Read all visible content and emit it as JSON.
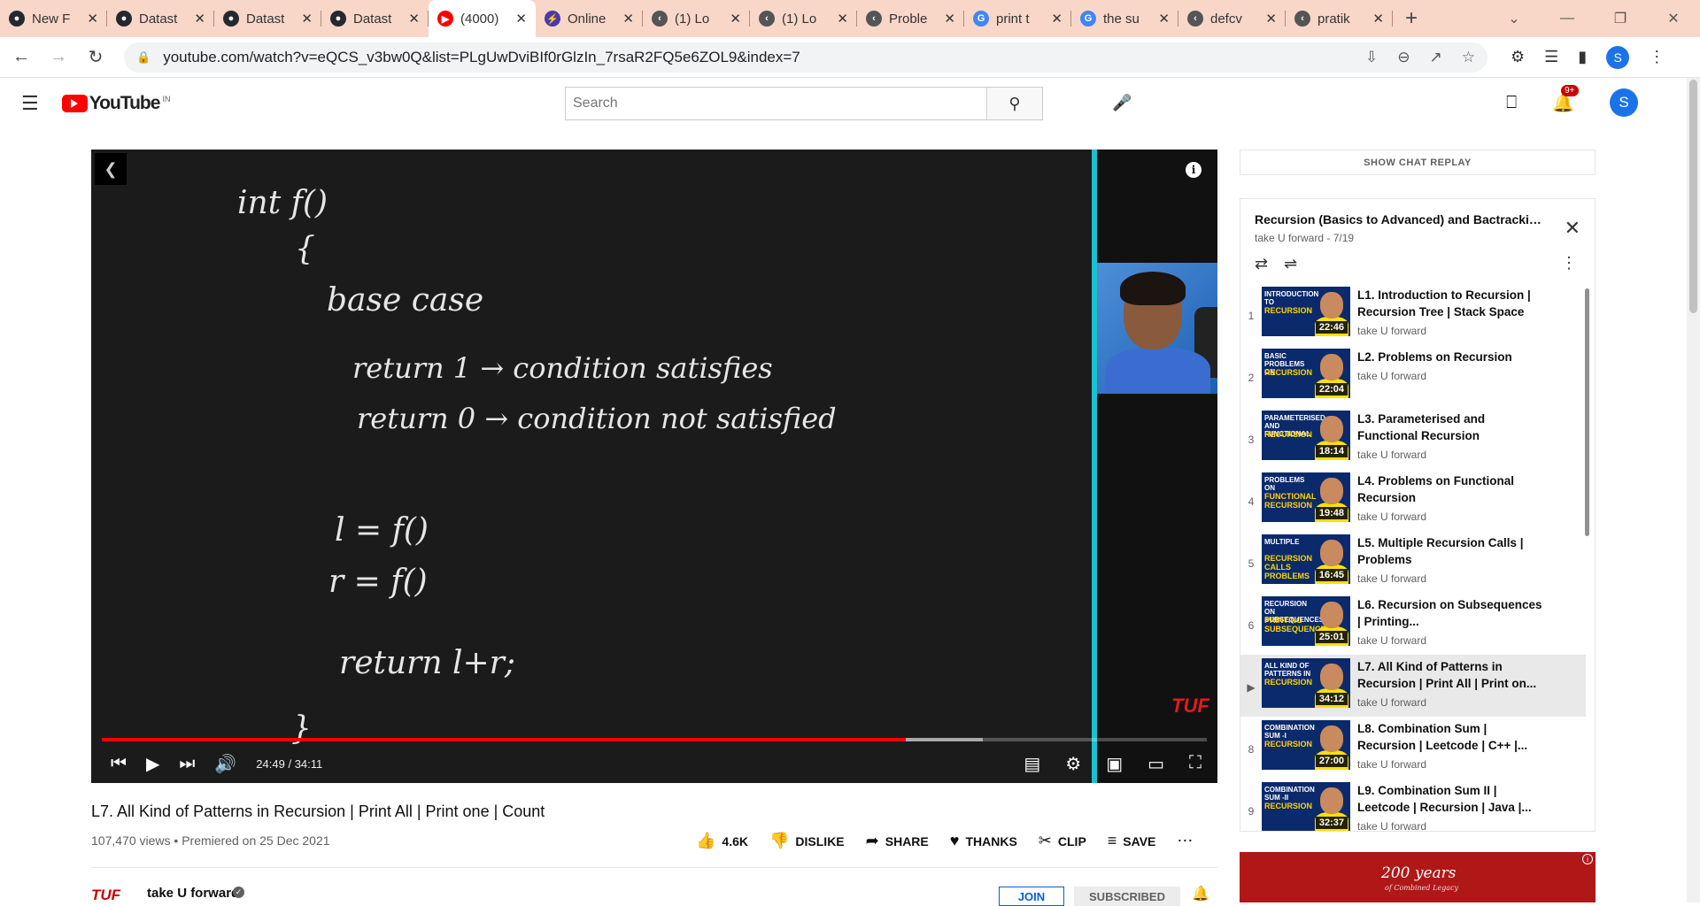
{
  "browser": {
    "tabs": [
      {
        "title": "New F",
        "icon": "github-icon",
        "color": "#24292f"
      },
      {
        "title": "Datast",
        "icon": "github-icon",
        "color": "#24292f"
      },
      {
        "title": "Datast",
        "icon": "github-icon",
        "color": "#24292f"
      },
      {
        "title": "Datast",
        "icon": "github-icon",
        "color": "#24292f"
      },
      {
        "title": "(4000)",
        "icon": "youtube-icon",
        "color": "#ff0000",
        "active": true
      },
      {
        "title": "Online",
        "icon": "bolt-icon",
        "color": "#4b3aa8"
      },
      {
        "title": "(1) Lo",
        "icon": "leetcode-icon",
        "color": "#555555"
      },
      {
        "title": "(1) Lo",
        "icon": "leetcode-icon",
        "color": "#555555"
      },
      {
        "title": "Proble",
        "icon": "leetcode-icon",
        "color": "#555555"
      },
      {
        "title": "print t",
        "icon": "google-icon",
        "color": "#4285f4"
      },
      {
        "title": "the su",
        "icon": "google-icon",
        "color": "#4285f4"
      },
      {
        "title": "defcv",
        "icon": "leetcode-icon",
        "color": "#555555"
      },
      {
        "title": "pratik",
        "icon": "leetcode-icon",
        "color": "#555555"
      }
    ],
    "url": "youtube.com/watch?v=eQCS_v3bw0Q&list=PLgUwDviBIf0rGlzIn_7rsaR2FQ5e6ZOL9&index=7"
  },
  "header": {
    "logo_text": "YouTube",
    "region": "IN",
    "search_placeholder": "Search",
    "notif_count": "9+",
    "avatar_letter": "S"
  },
  "player": {
    "board_lines": [
      "int f()",
      "{",
      "base case",
      "return 1 → condition satisfies",
      "return 0 → condition not satisfied",
      "l = f()",
      "r = f()",
      "return l+r;",
      "}"
    ],
    "watermark": "TUF",
    "current_time": "24:49",
    "total_time": "34:11",
    "played_fraction": 0.7275,
    "buffered_fraction": 0.7975
  },
  "video": {
    "title": "L7. All Kind of Patterns in Recursion | Print All | Print one | Count",
    "views": "107,470 views",
    "premiered": "Premiered on 25 Dec 2021",
    "actions": [
      {
        "label": "4.6K",
        "icon": "thumbs-up-icon"
      },
      {
        "label": "DISLIKE",
        "icon": "thumbs-down-icon"
      },
      {
        "label": "SHARE",
        "icon": "share-icon"
      },
      {
        "label": "THANKS",
        "icon": "thanks-icon"
      },
      {
        "label": "CLIP",
        "icon": "scissors-icon"
      },
      {
        "label": "SAVE",
        "icon": "save-playlist-icon"
      }
    ],
    "channel_logo": "TUF",
    "channel_name": "take U forward",
    "join": "JOIN",
    "subscribed": "SUBSCRIBED"
  },
  "sidebar": {
    "chat_replay": "SHOW CHAT REPLAY",
    "playlist_title": "Recursion (Basics to Advanced) and Bactracking S...",
    "playlist_owner": "take U forward",
    "playlist_position": "7/19",
    "items": [
      {
        "index": "1",
        "title": "L1. Introduction to Recursion | Recursion Tree | Stack Space",
        "channel": "take U forward",
        "duration": "22:46",
        "thumb_line1": "INTRODUCTION TO",
        "thumb_line2": "RECURSION"
      },
      {
        "index": "2",
        "title": "L2. Problems on Recursion",
        "channel": "take U forward",
        "duration": "22:04",
        "thumb_line1": "BASIC PROBLEMS ON",
        "thumb_line2": "RECURSION"
      },
      {
        "index": "3",
        "title": "L3. Parameterised and Functional Recursion",
        "channel": "take U forward",
        "duration": "18:14",
        "thumb_line1": "PARAMETERISED AND FUNCTIONAL",
        "thumb_line2": "RECURSION"
      },
      {
        "index": "4",
        "title": "L4. Problems on Functional Recursion",
        "channel": "take U forward",
        "duration": "19:48",
        "thumb_line1": "PROBLEMS ON",
        "thumb_line2": "FUNCTIONAL RECURSION"
      },
      {
        "index": "5",
        "title": "L5. Multiple Recursion Calls | Problems",
        "channel": "take U forward",
        "duration": "16:45",
        "thumb_line1": "MULTIPLE",
        "thumb_line2": "RECURSION CALLS PROBLEMS"
      },
      {
        "index": "6",
        "title": "L6. Recursion on Subsequences | Printing...",
        "channel": "take U forward",
        "duration": "25:01",
        "thumb_line1": "RECURSION ON SUBSEQUENCES",
        "thumb_line2": "PRINTING SUBSEQUENCES"
      },
      {
        "index": "▶",
        "title": "L7. All Kind of Patterns in Recursion | Print All | Print on...",
        "channel": "take U forward",
        "duration": "34:12",
        "thumb_line1": "ALL KIND OF PATTERNS IN",
        "thumb_line2": "RECURSION",
        "current": true
      },
      {
        "index": "8",
        "title": "L8. Combination Sum | Recursion | Leetcode | C++ |...",
        "channel": "take U forward",
        "duration": "27:00",
        "thumb_line1": "COMBINATION SUM -I",
        "thumb_line2": "RECURSION"
      },
      {
        "index": "9",
        "title": "L9. Combination Sum II | Leetcode | Recursion | Java |...",
        "channel": "take U forward",
        "duration": "32:37",
        "thumb_line1": "COMBINATION SUM -II",
        "thumb_line2": "RECURSION"
      }
    ],
    "ad_text": "200 years",
    "ad_sub": "of Combined Legacy"
  }
}
